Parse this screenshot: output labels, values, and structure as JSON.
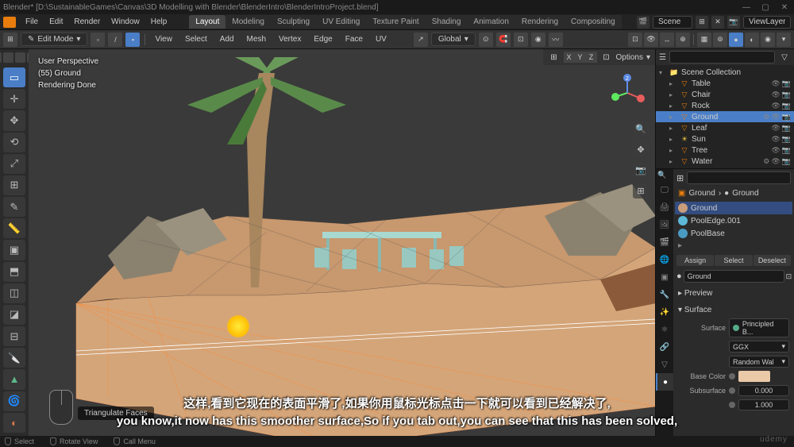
{
  "titlebar": {
    "title": "Blender* [D:\\SustainableGames\\Canvas\\3D Modelling with Blender\\BlenderIntro\\BlenderIntroProject.blend]"
  },
  "menu": {
    "items": [
      "File",
      "Edit",
      "Render",
      "Window",
      "Help"
    ],
    "tabs": [
      "Layout",
      "Modeling",
      "Sculpting",
      "UV Editing",
      "Texture Paint",
      "Shading",
      "Animation",
      "Rendering",
      "Compositing"
    ],
    "active_tab": "Layout",
    "scene_label": "Scene",
    "viewlayer_label": "ViewLayer"
  },
  "toolbar": {
    "mode": "Edit Mode",
    "view": "View",
    "select": "Select",
    "add": "Add",
    "mesh": "Mesh",
    "vertex": "Vertex",
    "edge": "Edge",
    "face": "Face",
    "uv": "UV",
    "global": "Global",
    "options": "Options"
  },
  "viewport": {
    "info1": "User Perspective",
    "info2": "(55) Ground",
    "info3": "Rendering Done",
    "xyz": [
      "X",
      "Y",
      "Z"
    ],
    "triangulate": "Triangulate Faces"
  },
  "outliner": {
    "collection": "Scene Collection",
    "items": [
      {
        "name": "Table",
        "icon": "▽",
        "color": "#e87d0d"
      },
      {
        "name": "Chair",
        "icon": "▽",
        "color": "#e87d0d"
      },
      {
        "name": "Rock",
        "icon": "▽",
        "color": "#e87d0d"
      },
      {
        "name": "Ground",
        "icon": "▽",
        "color": "#e87d0d",
        "active": true
      },
      {
        "name": "Leaf",
        "icon": "▽",
        "color": "#e87d0d"
      },
      {
        "name": "Sun",
        "icon": "☀",
        "color": "#e8a23c"
      },
      {
        "name": "Tree",
        "icon": "▽",
        "color": "#e87d0d"
      },
      {
        "name": "Water",
        "icon": "▽",
        "color": "#e87d0d"
      }
    ]
  },
  "props": {
    "breadcrumb_obj": "Ground",
    "breadcrumb_mat": "Ground",
    "materials": [
      {
        "name": "Ground",
        "color": "#c99d7a",
        "selected": true
      },
      {
        "name": "PoolEdge.001",
        "color": "#5eb8d8"
      },
      {
        "name": "PoolBase",
        "color": "#4a9bc4"
      }
    ],
    "assign": "Assign",
    "select": "Select",
    "deselect": "Deselect",
    "mat_name": "Ground",
    "preview": "Preview",
    "surface_header": "Surface",
    "surface_label": "Surface",
    "surface_value": "Principled B...",
    "ggx": "GGX",
    "random_walk": "Random Wal",
    "base_color_label": "Base Color",
    "base_color": "#eac9a8",
    "subsurface_label": "Subsurface",
    "subsurface_value": "0.000",
    "subsurface2_value": "1.000"
  },
  "status": {
    "select_label": "Select",
    "rotate_label": "Rotate View",
    "call_menu": "Call Menu"
  },
  "subtitles": {
    "line1": "这样,看到它现在的表面平滑了,如果你用鼠标光标点击一下就可以看到已经解决了,",
    "line2": "you know,it now has this smoother surface,So if you tab out,you can see that this has been solved,"
  },
  "watermark": "udemy"
}
